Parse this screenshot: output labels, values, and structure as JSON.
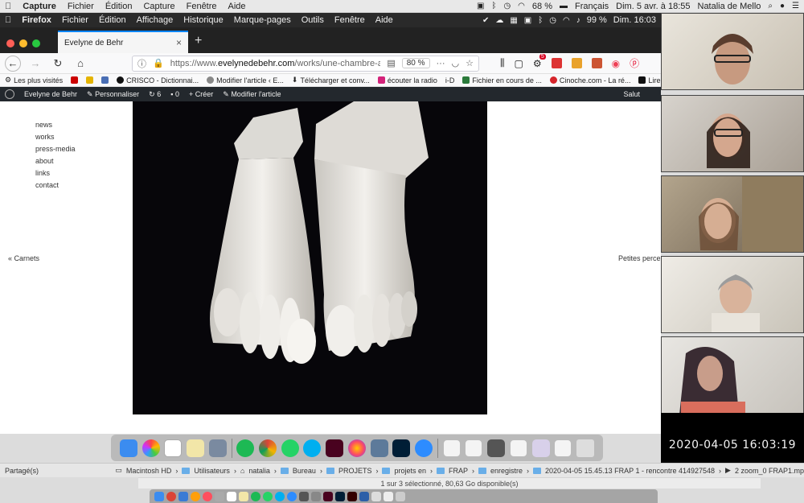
{
  "outer_menubar": {
    "app": "Capture",
    "menus": [
      "Fichier",
      "Édition",
      "Capture",
      "Fenêtre",
      "Aide"
    ],
    "battery": "68 %",
    "language": "Français",
    "datetime": "Dim. 5 avr. à 18:55",
    "user": "Natalia de Mello"
  },
  "inner_menubar": {
    "app": "Firefox",
    "menus": [
      "Fichier",
      "Édition",
      "Affichage",
      "Historique",
      "Marque-pages",
      "Outils",
      "Fenêtre",
      "Aide"
    ],
    "battery": "99 %",
    "datetime": "Dim. 16:03"
  },
  "browser": {
    "tab_title": "Evelyne de Behr",
    "url_prefix": "https://www.",
    "url_domain": "evelynedebehr.com",
    "url_path": "/works/une-chambre-a-soi-ou-",
    "zoom": "80 %",
    "extension_badge": "5"
  },
  "bookmarks": [
    "Les plus visités",
    "CRISCO - Dictionnai...",
    "Modifier l'article ‹ E...",
    "Télécharger et conv...",
    "écouter la radio",
    "i-D",
    "Fichier en cours de ...",
    "Cinoche.com - La ré...",
    "Lire des fem"
  ],
  "wp_admin": {
    "site": "Evelyne de Behr",
    "customize": "Personnaliser",
    "updates": "6",
    "comments": "0",
    "new": "Créer",
    "edit": "Modifier l'article",
    "greeting": "Salut"
  },
  "site_nav": [
    "news",
    "works",
    "press-media",
    "about",
    "links",
    "contact"
  ],
  "prev_link": "Carnets",
  "next_link": "Petites percep",
  "video_timestamp": "2020-04-05  16:03:19",
  "finder": {
    "shared": "Partagé(s)",
    "path": [
      "Macintosh HD",
      "Utilisateurs",
      "natalia",
      "Bureau",
      "PROJETS",
      "projets en",
      "FRAP",
      "enregistre",
      "2020-04-05 15.45.13 FRAP 1 - rencontre 414927548",
      "2 zoom_0 FRAP1.mp"
    ],
    "status": "1 sur 3 sélectionné, 80,63 Go disponible(s)"
  },
  "colors": {
    "tab_accent": "#0a84ff",
    "wp_bar": "#23282d",
    "artwork_bg": "#07060a"
  }
}
